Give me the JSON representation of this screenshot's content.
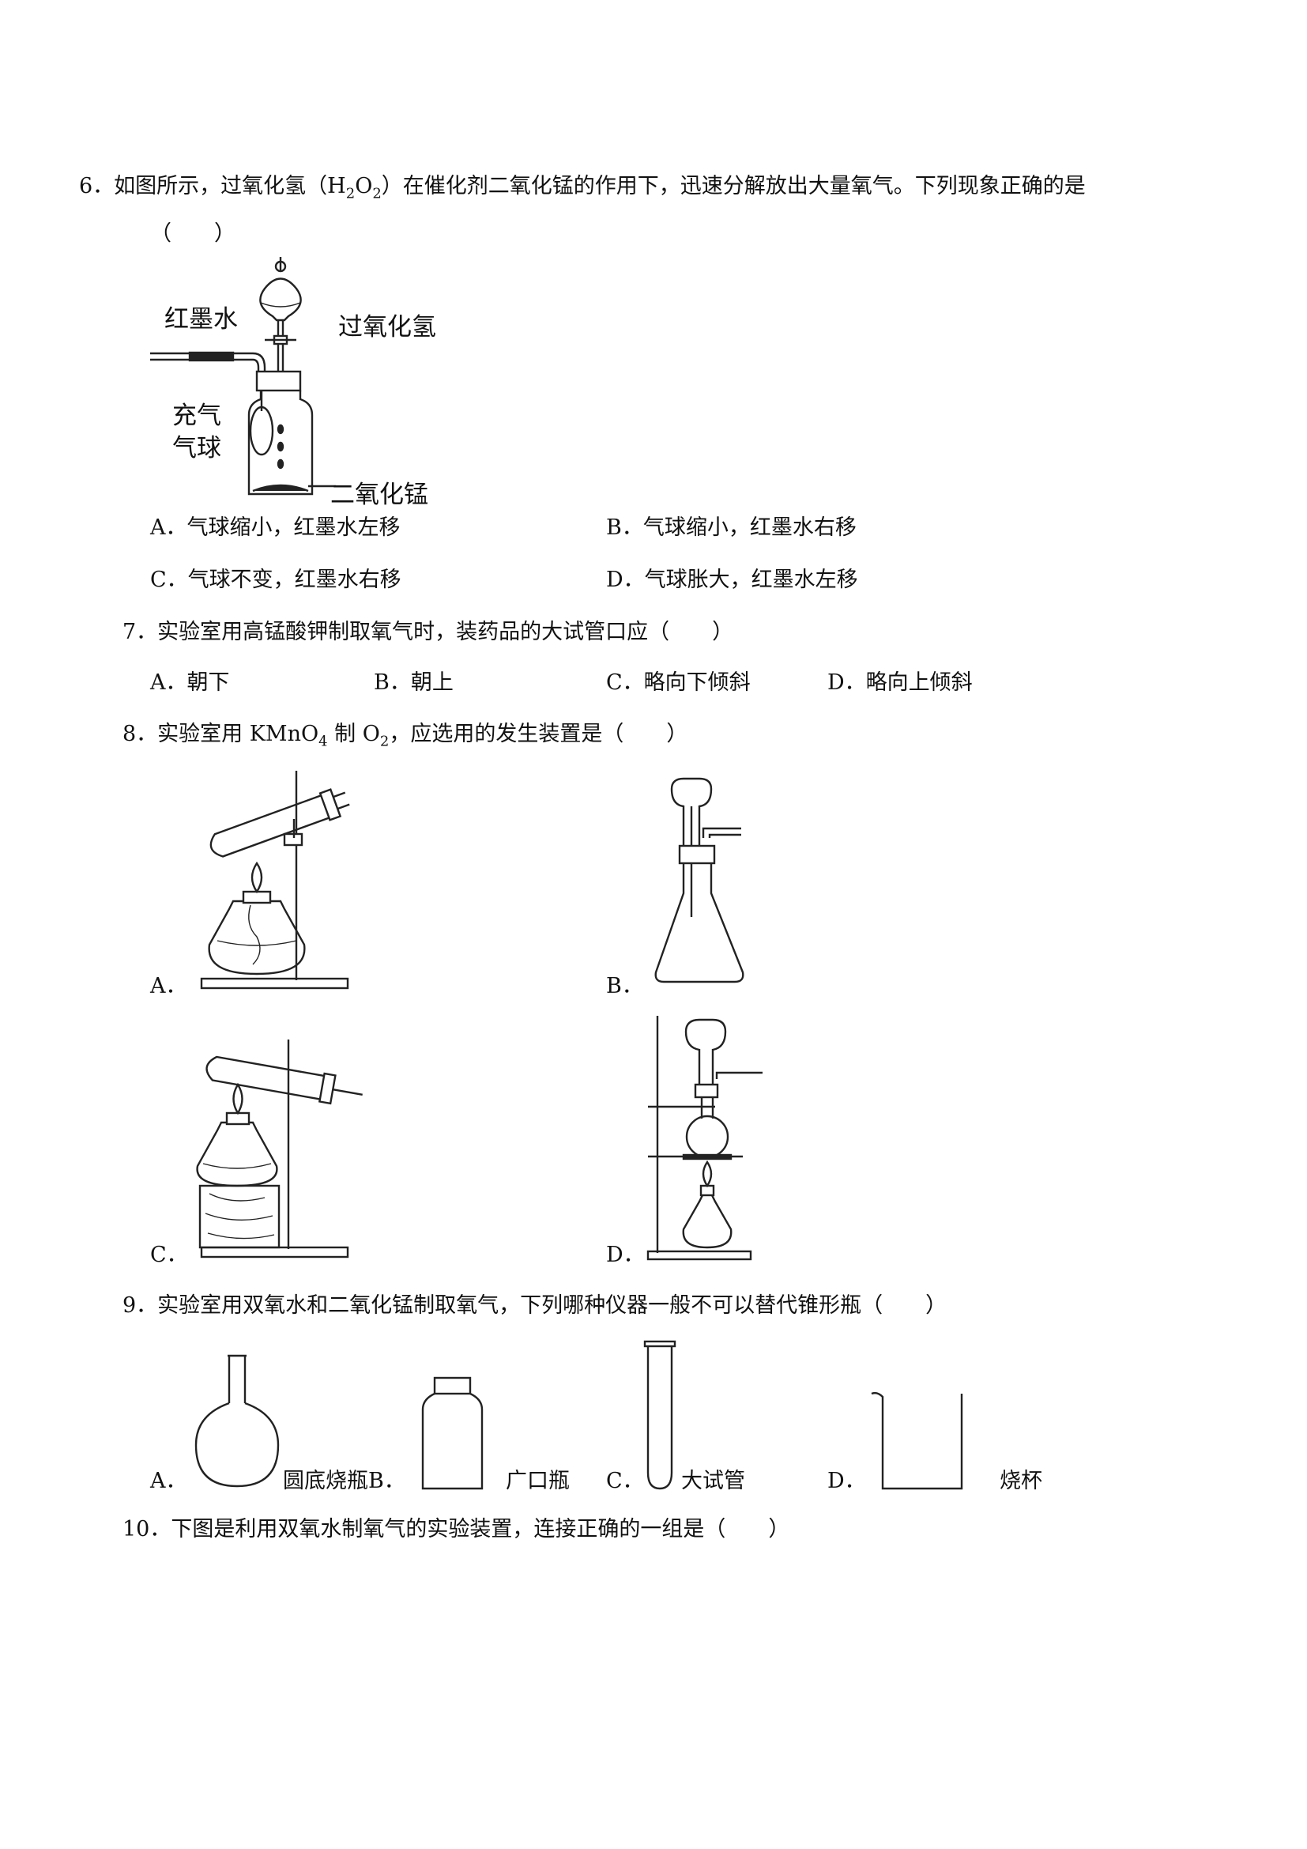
{
  "q6": {
    "stem_pre": "6．如图所示，过氧化氢（H",
    "sub1": "2",
    "mid": "O",
    "sub2": "2",
    "stem_post": "）在催化剂二氧化锰的作用下，迅速分解放出大量氧气。下列现象正确的是",
    "paren": "（　　）",
    "figure_labels": {
      "red_ink": "红墨水",
      "h2o2": "过氧化氢",
      "balloon_l1": "充气",
      "balloon_l2": "气球",
      "mno2": "二氧化锰"
    },
    "options": {
      "A": "A．气球缩小，红墨水左移",
      "B": "B．气球缩小，红墨水右移",
      "C": "C．气球不变，红墨水右移",
      "D": "D．气球胀大，红墨水左移"
    }
  },
  "q7": {
    "stem": "7．实验室用高锰酸钾制取氧气时，装药品的大试管口应（　　）",
    "options": {
      "A": "A．朝下",
      "B": "B．朝上",
      "C": "C．略向下倾斜",
      "D": "D．略向上倾斜"
    }
  },
  "q8": {
    "stem_pre": "8．实验室用 KMnO",
    "sub1": "4",
    "stem_mid": " 制 O",
    "sub2": "2",
    "stem_post": "，应选用的发生装置是（　　）",
    "option_labels": {
      "A": "A．",
      "B": "B．",
      "C": "C．",
      "D": "D．"
    }
  },
  "q9": {
    "stem": "9．实验室用双氧水和二氧化锰制取氧气，下列哪种仪器一般不可以替代锥形瓶（　　）",
    "option_labels": {
      "A": "A．",
      "B": "B．",
      "C": "C．",
      "D": "D．"
    },
    "option_names": {
      "A": "圆底烧瓶",
      "B": "广口瓶",
      "C": "大试管",
      "D": "烧杯"
    }
  },
  "q10": {
    "stem": "10．下图是利用双氧水制氧气的实验装置，连接正确的一组是（　　）"
  }
}
